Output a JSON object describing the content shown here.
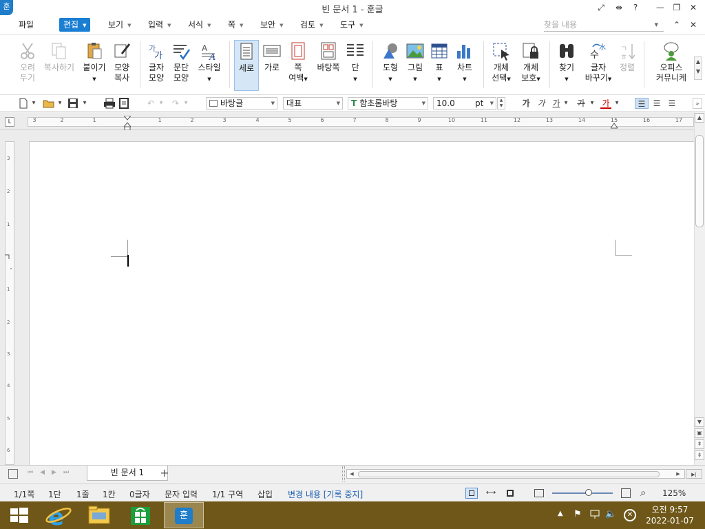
{
  "titlebar": {
    "title": "빈 문서 1 - 훈글",
    "logo": "훈",
    "help": "?"
  },
  "menu": {
    "file": "파일",
    "items": [
      {
        "label": "편집"
      },
      {
        "label": "보기"
      },
      {
        "label": "입력"
      },
      {
        "label": "서식"
      },
      {
        "label": "쪽"
      },
      {
        "label": "보안"
      },
      {
        "label": "검토"
      },
      {
        "label": "도구"
      }
    ],
    "search_placeholder": "찾을 내용"
  },
  "ribbon": {
    "cut": [
      "오려",
      "두기"
    ],
    "copy": "복사하기",
    "paste": "붙이기",
    "format_copy": [
      "모양",
      "복사"
    ],
    "char_shape": [
      "글자",
      "모양"
    ],
    "para_shape": [
      "문단",
      "모양"
    ],
    "style": "스타일",
    "portrait": "세로",
    "landscape": "가로",
    "margin": [
      "쪽",
      "여백"
    ],
    "background": "바탕쪽",
    "column": "단",
    "shape": "도형",
    "picture": "그림",
    "table": "표",
    "chart": "차트",
    "obj_select": [
      "개체",
      "선택"
    ],
    "obj_protect": [
      "개체",
      "보호"
    ],
    "find": "찾기",
    "replace": [
      "글자",
      "바꾸기"
    ],
    "sort": "정렬",
    "office": [
      "오피스",
      "커뮤니케"
    ]
  },
  "format": {
    "style_name": "바탕글",
    "language": "대표",
    "font": "함초롬바탕",
    "font_size": "10.0",
    "unit": "pt",
    "bold": "가",
    "italic": "가",
    "underline": "가",
    "strike": "가",
    "color_char": "가"
  },
  "ruler": {
    "h_numbers": [
      "3",
      "2",
      "1",
      "1",
      "2",
      "3",
      "4",
      "5",
      "6",
      "7",
      "8",
      "9",
      "10",
      "11",
      "12",
      "13",
      "14",
      "15",
      "16",
      "17"
    ],
    "v_numbers": [
      "3",
      "2",
      "1",
      "1",
      "2",
      "3",
      "4",
      "5",
      "6"
    ]
  },
  "doc_tab": {
    "label": "빈 문서 1"
  },
  "status": {
    "page": "1/1쪽",
    "column": "1단",
    "line": "1줄",
    "col": "1칸",
    "chars": "0글자",
    "mode": "문자 입력",
    "section": "1/1 구역",
    "insert": "삽입",
    "track": "변경 내용 [기록 중지]",
    "zoom": "125%",
    "zoom_level": 0.6
  },
  "taskbar": {
    "time": "오전 9:57",
    "date": "2022-01-07",
    "hwp_icon": "훈"
  },
  "colors": {
    "accent": "#1a7ed2",
    "taskbar": "#6e5718"
  }
}
